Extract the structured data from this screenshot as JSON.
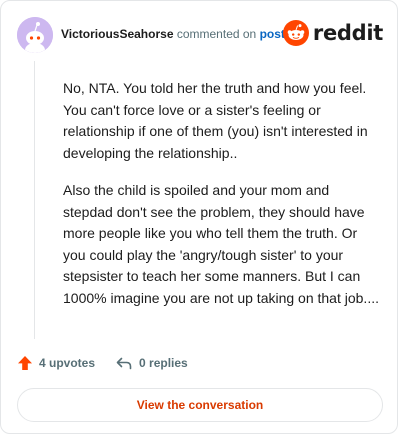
{
  "header": {
    "username": "VictoriousSeahorse",
    "action_text": "commented on",
    "post_link": "post",
    "brand_word": "reddit"
  },
  "comment": {
    "paragraphs": [
      "No, NTA. You told her the truth and how you feel. You can't force love or a sister's feeling or relationship if one of them (you) isn't interested in developing the relationship..",
      "Also the child is spoiled and your mom and stepdad don't see the problem, they should have more people like you who tell them the truth. Or you could play the 'angry/tough sister' to your stepsister to teach her some manners. But I can 1000% imagine you are not up taking on that job...."
    ]
  },
  "actions": {
    "upvotes_label": "4 upvotes",
    "replies_label": "0 replies",
    "upvote_icon": "upvote-arrow-icon",
    "reply_icon": "reply-arrow-icon"
  },
  "footer": {
    "view_button_label": "View the conversation"
  },
  "colors": {
    "brand": "#ff4500",
    "link": "#0a66c2",
    "avatar_bg": "#cdb8f0",
    "view_button_text": "#d93a00"
  }
}
